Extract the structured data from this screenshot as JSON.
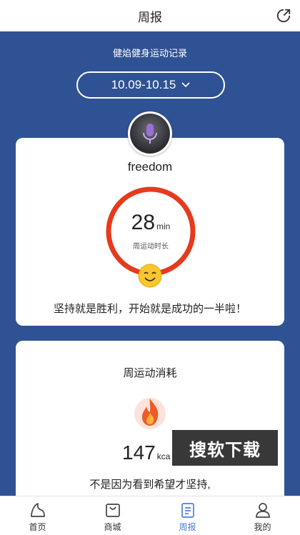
{
  "header": {
    "title": "周报"
  },
  "summary": {
    "subtitle": "健焰健身运动记录",
    "date_range": "10.09-10.15",
    "username": "freedom",
    "weekly_minutes": "28",
    "minutes_unit": "min",
    "minutes_label": "周运动时长",
    "motto": "坚持就是胜利，开始就是成功的一半啦！"
  },
  "consumption": {
    "title": "周运动消耗",
    "value": "147",
    "unit": "kca",
    "motto": "不是因为看到希望才坚持,"
  },
  "watermark": "搜软下载",
  "tabs": [
    {
      "label": "首页",
      "icon": "home-icon"
    },
    {
      "label": "商城",
      "icon": "shopping-bag-icon"
    },
    {
      "label": "周报",
      "icon": "report-icon",
      "active": true
    },
    {
      "label": "我的",
      "icon": "profile-icon"
    }
  ],
  "colors": {
    "background": "#2f5294",
    "ring": "#e63a1e",
    "active_tab": "#4d7fd8"
  }
}
